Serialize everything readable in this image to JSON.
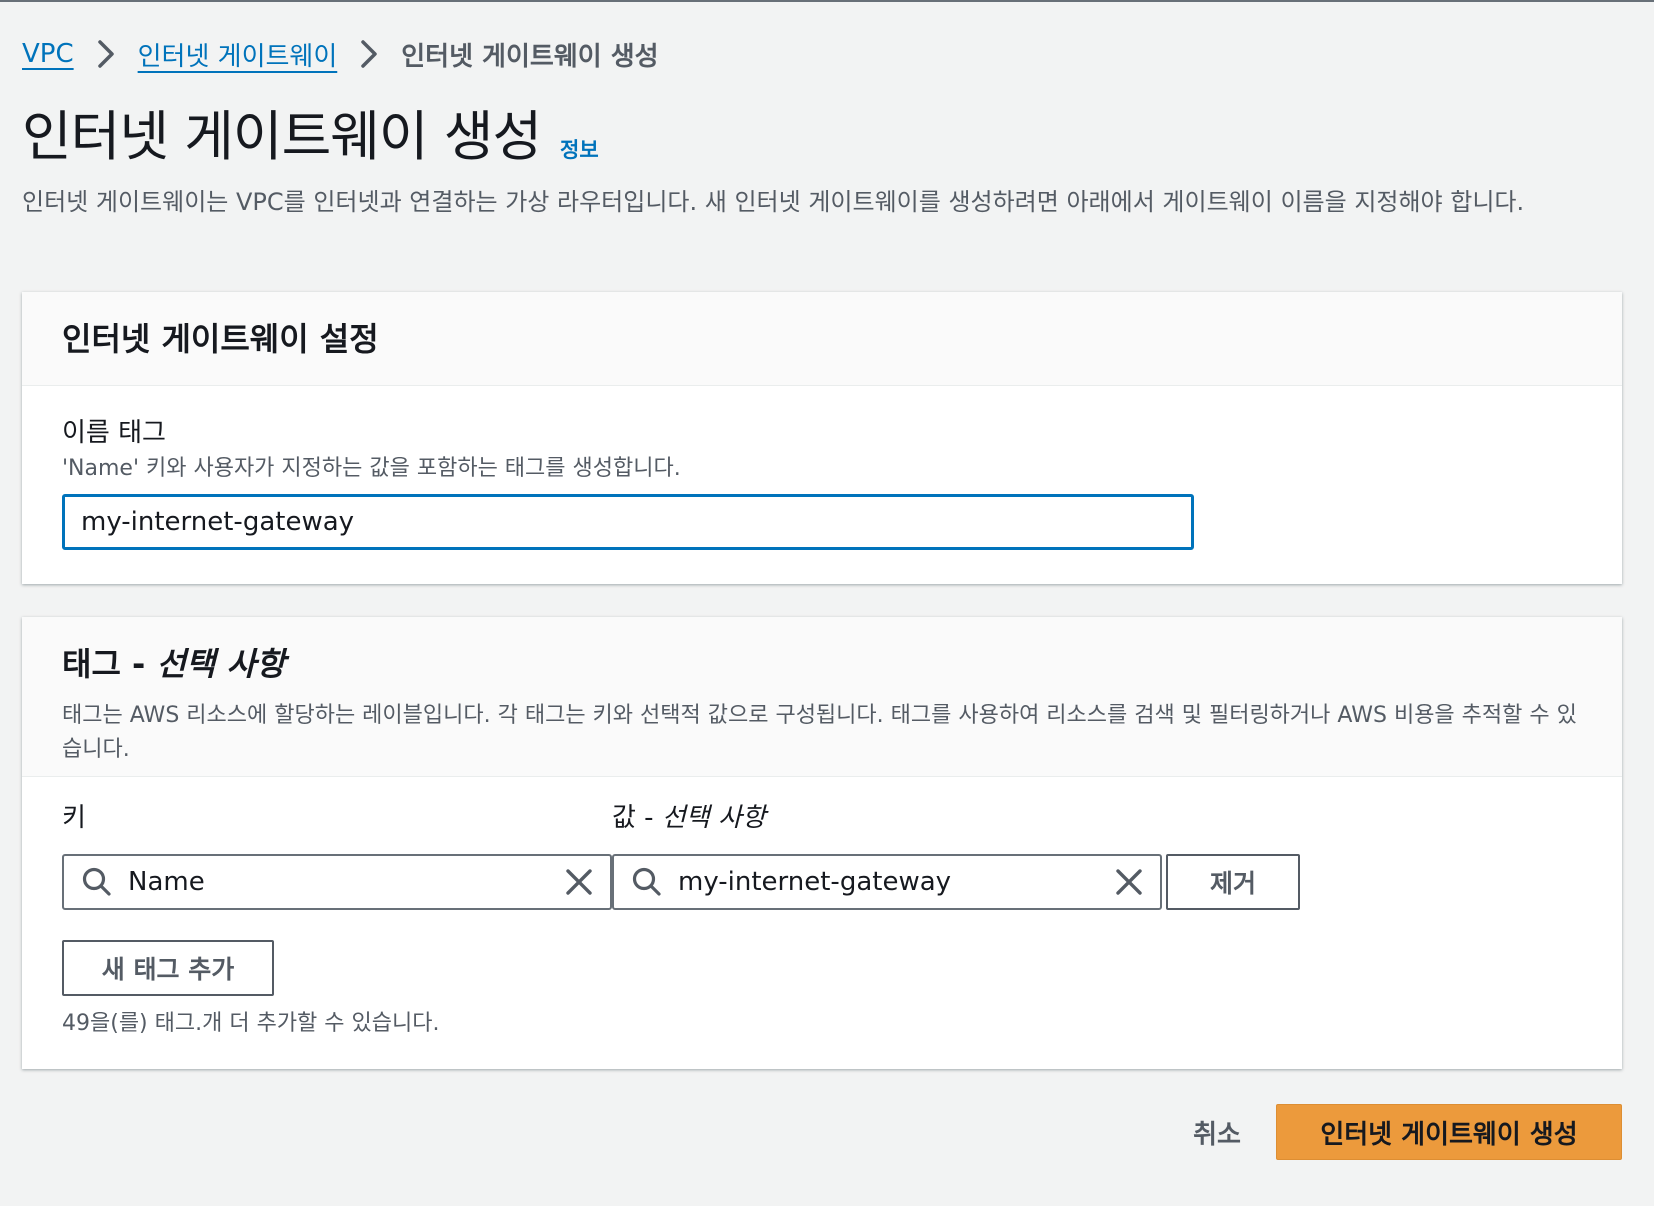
{
  "breadcrumb": {
    "items": [
      "VPC",
      "인터넷 게이트웨이"
    ],
    "current": "인터넷 게이트웨이 생성"
  },
  "header": {
    "title": "인터넷 게이트웨이 생성",
    "info_link": "정보",
    "description": "인터넷 게이트웨이는 VPC를 인터넷과 연결하는 가상 라우터입니다. 새 인터넷 게이트웨이를 생성하려면 아래에서 게이트웨이 이름을 지정해야 합니다."
  },
  "settings": {
    "title": "인터넷 게이트웨이 설정",
    "name_tag_label": "이름 태그",
    "name_tag_desc": "'Name' 키와 사용자가 지정하는 값을 포함하는 태그를 생성합니다.",
    "name_tag_value": "my-internet-gateway"
  },
  "tags": {
    "title_main": "태그 - ",
    "title_optional": "선택 사항",
    "description": "태그는 AWS 리소스에 할당하는 레이블입니다. 각 태그는 키와 선택적 값으로 구성됩니다. 태그를 사용하여 리소스를 검색 및 필터링하거나 AWS 비용을 추적할 수 있습니다.",
    "key_label": "키",
    "value_label_main": "값 - ",
    "value_label_optional": "선택 사항",
    "rows": [
      {
        "key": "Name",
        "value": "my-internet-gateway"
      }
    ],
    "remove_button": "제거",
    "add_button": "새 태그 추가",
    "limit_text": "49을(를) 태그.개 더 추가할 수 있습니다."
  },
  "footer": {
    "cancel": "취소",
    "create": "인터넷 게이트웨이 생성"
  },
  "colors": {
    "link": "#0073bb",
    "primary_button": "#ec9a3c",
    "focus_border": "#0073bb",
    "background": "#f2f3f3"
  },
  "icons": [
    "chevron-right-icon",
    "search-icon",
    "clear-icon"
  ]
}
